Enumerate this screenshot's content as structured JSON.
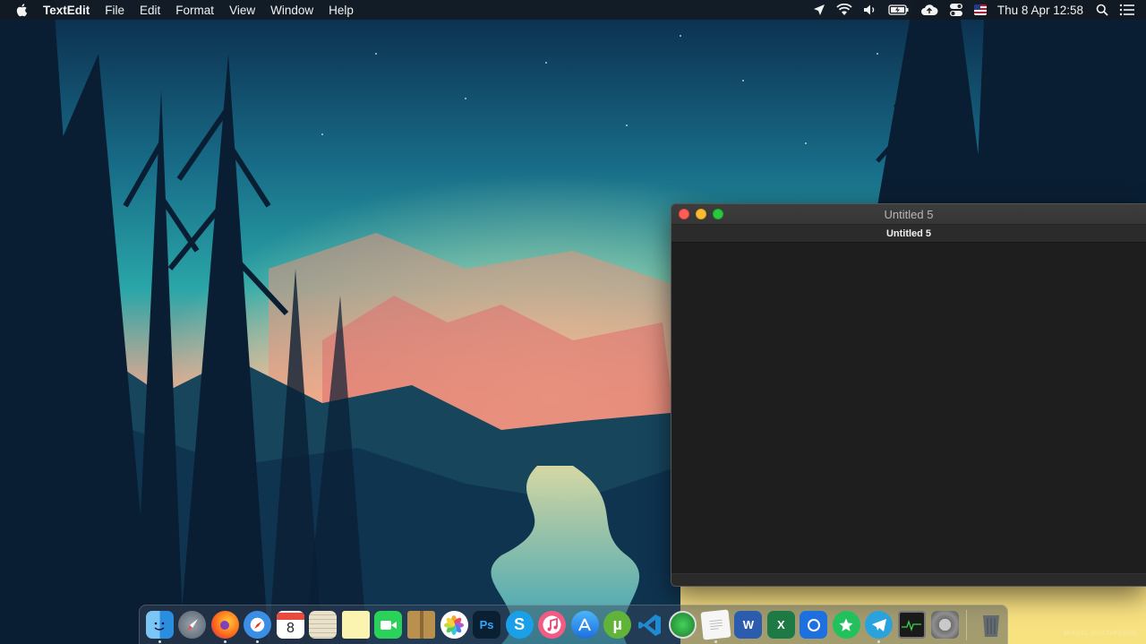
{
  "menubar": {
    "app_name": "TextEdit",
    "menus": [
      "File",
      "Edit",
      "Format",
      "View",
      "Window",
      "Help"
    ],
    "battery_label": "",
    "clock": "Thu 8 Apr  12:58"
  },
  "window": {
    "title": "Untitled 5",
    "tab_label": "Untitled 5",
    "document_text": ""
  },
  "dock": {
    "items": [
      {
        "name": "finder-icon",
        "running": true
      },
      {
        "name": "launchpad-icon",
        "running": false
      },
      {
        "name": "firefox-icon",
        "running": true
      },
      {
        "name": "safari-icon",
        "running": true
      },
      {
        "name": "calendar-icon",
        "running": false,
        "text": "8"
      },
      {
        "name": "notes-icon",
        "running": false
      },
      {
        "name": "stickies-icon",
        "running": false
      },
      {
        "name": "facetime-icon",
        "running": false
      },
      {
        "name": "archive-utility-icon",
        "running": false
      },
      {
        "name": "photos-icon",
        "running": false
      },
      {
        "name": "photoshop-icon",
        "running": false,
        "text": "Ps"
      },
      {
        "name": "skype-icon",
        "running": false,
        "text": "S"
      },
      {
        "name": "itunes-icon",
        "running": false
      },
      {
        "name": "app-store-icon",
        "running": false
      },
      {
        "name": "utorrent-icon",
        "running": false
      },
      {
        "name": "vscode-icon",
        "running": false
      },
      {
        "name": "green-app-icon",
        "running": false
      },
      {
        "name": "textedit-icon",
        "running": true
      },
      {
        "name": "word-icon",
        "running": false,
        "text": "W"
      },
      {
        "name": "excel-icon",
        "running": false,
        "text": "X"
      },
      {
        "name": "blue-app-icon",
        "running": false
      },
      {
        "name": "star-app-icon",
        "running": false
      },
      {
        "name": "telegram-icon",
        "running": true
      },
      {
        "name": "activity-monitor-icon",
        "running": false
      },
      {
        "name": "system-preferences-icon",
        "running": false
      },
      {
        "name": "trash-icon",
        "running": false
      }
    ]
  },
  "watermark": "MIKAEL GUSTAFSSON",
  "colors": {
    "close": "#ff5f57",
    "minimize": "#febc2e",
    "maximize": "#28c840"
  }
}
